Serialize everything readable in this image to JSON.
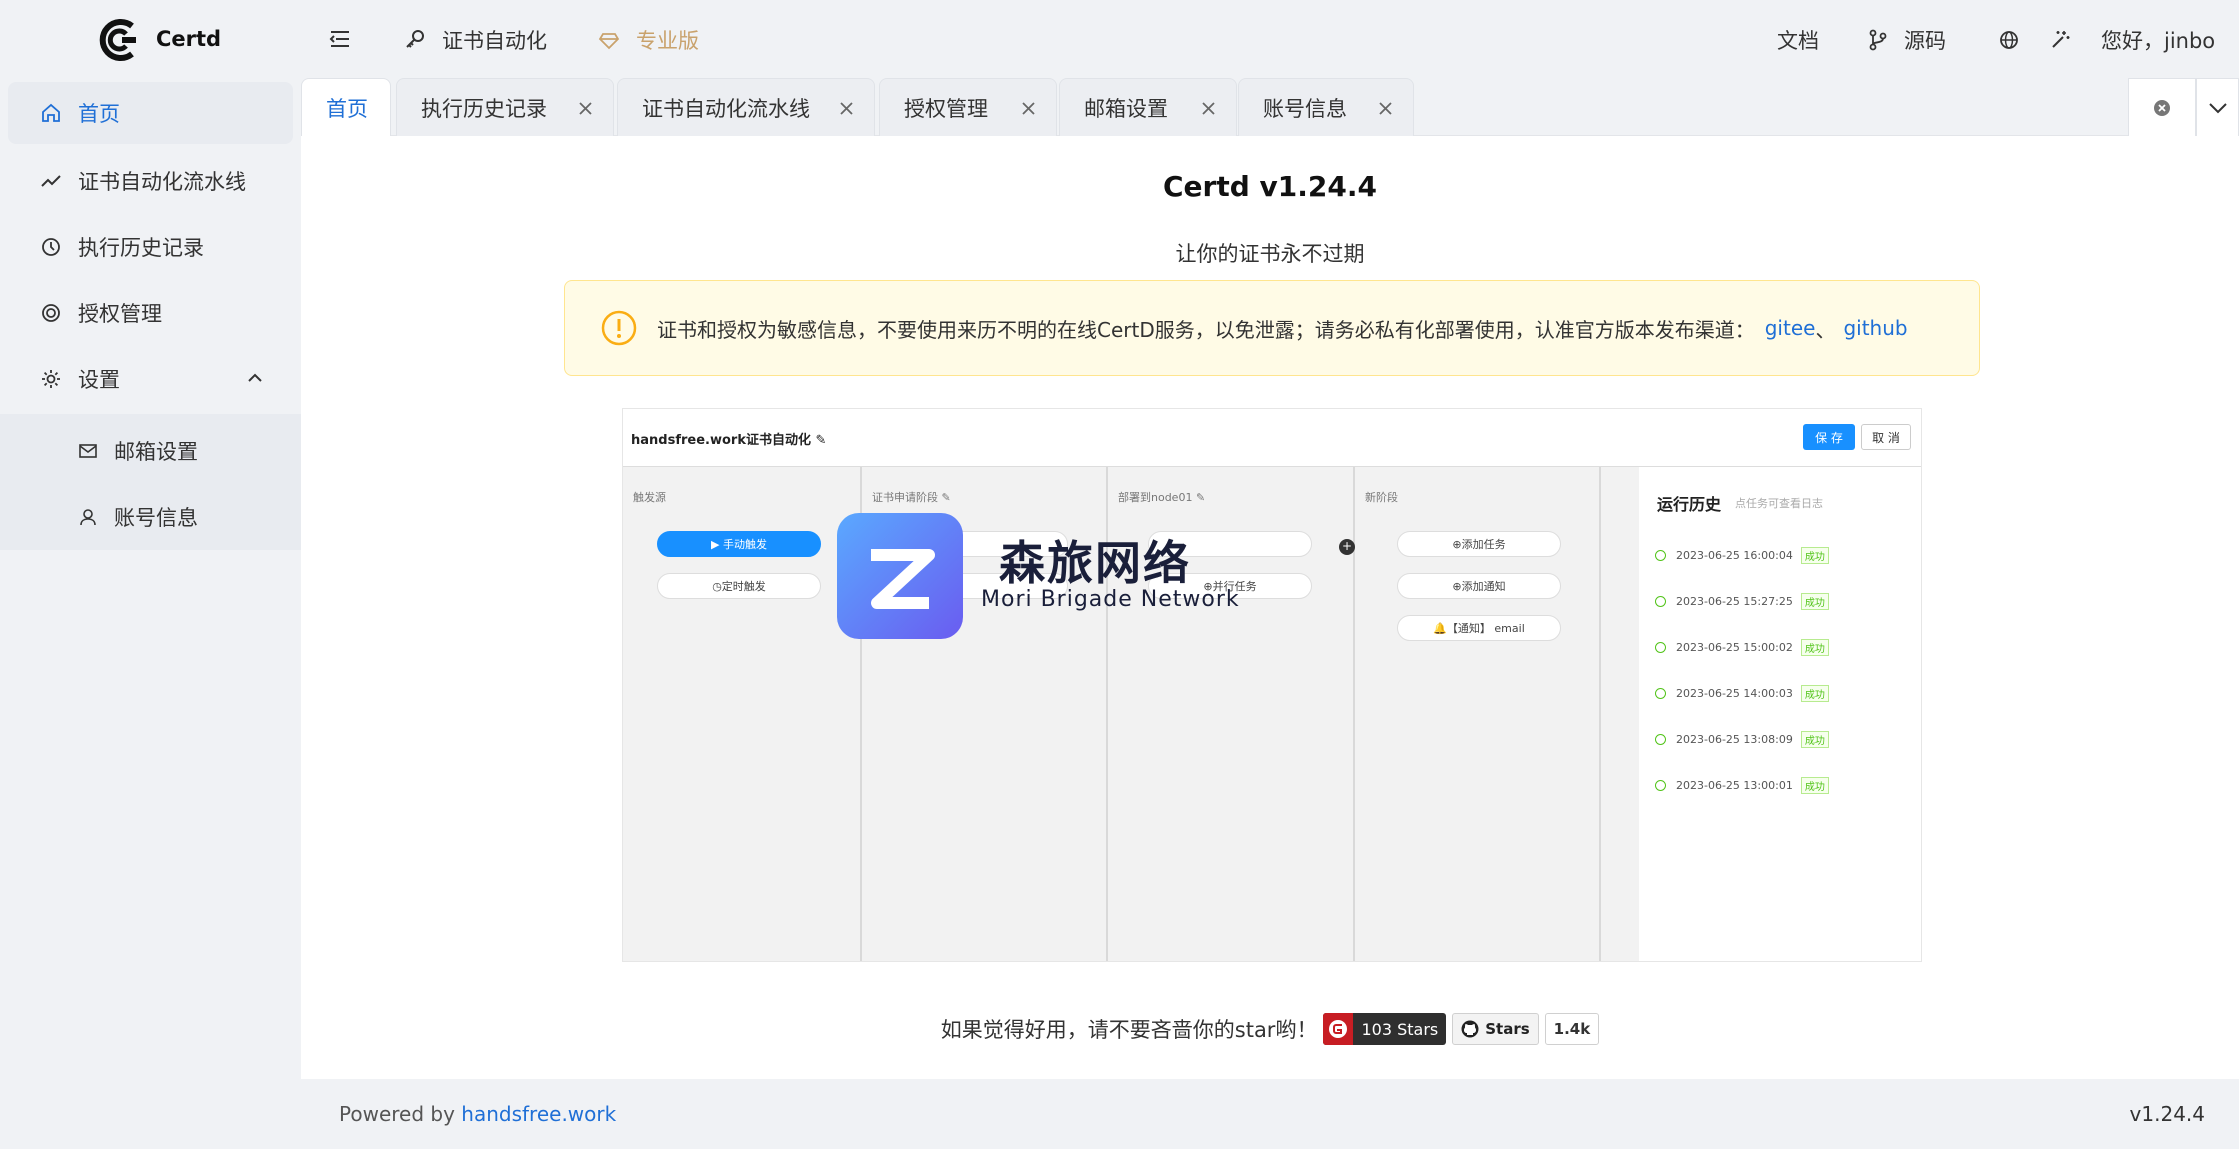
{
  "app": {
    "brand": "Certd"
  },
  "header": {
    "nav": [
      {
        "label": "证书自动化",
        "icon": "key-icon"
      },
      {
        "label": "专业版",
        "icon": "diamond-icon"
      }
    ],
    "docs": "文档",
    "source": "源码",
    "greeting": "您好，jinbo"
  },
  "sidebar": {
    "items": [
      {
        "label": "首页",
        "icon": "home-icon"
      },
      {
        "label": "证书自动化流水线",
        "icon": "trend-icon"
      },
      {
        "label": "执行历史记录",
        "icon": "history-icon"
      },
      {
        "label": "授权管理",
        "icon": "target-icon"
      },
      {
        "label": "设置",
        "icon": "gear-icon"
      }
    ],
    "sub": [
      {
        "label": "邮箱设置",
        "icon": "mail-icon"
      },
      {
        "label": "账号信息",
        "icon": "user-icon"
      }
    ]
  },
  "tabs": [
    {
      "label": "首页"
    },
    {
      "label": "执行历史记录"
    },
    {
      "label": "证书自动化流水线"
    },
    {
      "label": "授权管理"
    },
    {
      "label": "邮箱设置"
    },
    {
      "label": "账号信息"
    }
  ],
  "main": {
    "title": "Certd v1.24.4",
    "subtitle": "让你的证书永不过期",
    "alert_text": "证书和授权为敏感信息，不要使用来历不明的在线CertD服务，以免泄露；请务必私有化部署使用，认准官方版本发布渠道：",
    "alert_link1": "gitee",
    "alert_sep": "、",
    "alert_link2": "github",
    "star_text": "如果觉得好用，请不要吝啬你的star哟！",
    "gitee_stars": "103 Stars",
    "github_label": "Stars",
    "github_count": "1.4k"
  },
  "preview": {
    "title": "handsfree.work证书自动化",
    "save": "保 存",
    "cancel": "取 消",
    "col1": "触发源",
    "col2": "证书申请阶段",
    "col3": "部署到node01",
    "col4": "新阶段",
    "manual": "▶ 手动触发",
    "timer": "定时触发",
    "parallel": "并行任务",
    "add_task": "添加任务",
    "add_notify": "添加通知",
    "notify_email": "【通知】 email",
    "history_title": "运行历史",
    "history_sub": "点任务可查看日志",
    "history": [
      {
        "time": "2023-06-25 16:00:04",
        "status": "成功"
      },
      {
        "time": "2023-06-25 15:27:25",
        "status": "成功"
      },
      {
        "time": "2023-06-25 15:00:02",
        "status": "成功"
      },
      {
        "time": "2023-06-25 14:00:03",
        "status": "成功"
      },
      {
        "time": "2023-06-25 13:08:09",
        "status": "成功"
      },
      {
        "time": "2023-06-25 13:00:01",
        "status": "成功"
      }
    ],
    "watermark_cn": "森旅网络",
    "watermark_en": "Mori Brigade Network"
  },
  "footer": {
    "powered": "Powered by ",
    "link": "handsfree.work",
    "version": "v1.24.4"
  },
  "colors": {
    "accent": "#1f6fd6",
    "pro": "#c9a26c",
    "warn": "#faad14",
    "success": "#52c41a"
  }
}
